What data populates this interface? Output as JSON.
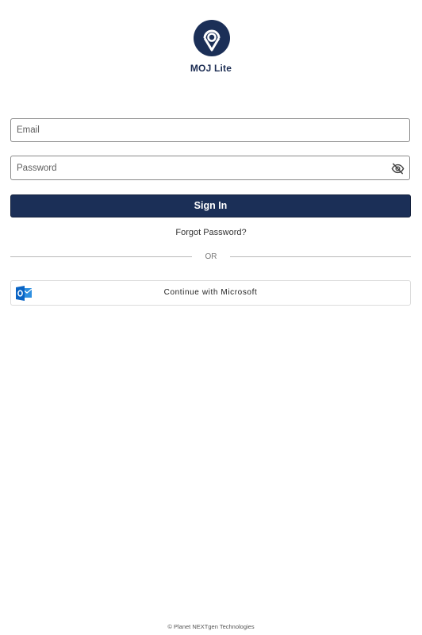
{
  "app": {
    "title": "MOJ Lite",
    "brand_color": "#1b2f57"
  },
  "form": {
    "email_placeholder": "Email",
    "email_value": "",
    "password_placeholder": "Password",
    "password_value": "",
    "password_toggle_icon": "eye-off-icon",
    "sign_in_label": "Sign In",
    "forgot_password_label": "Forgot Password?"
  },
  "divider": {
    "label": "OR"
  },
  "sso": {
    "microsoft_label": "Continue with Microsoft",
    "icon": "outlook-icon"
  },
  "footer": {
    "text": "© Planet NEXTgen Technologies"
  }
}
